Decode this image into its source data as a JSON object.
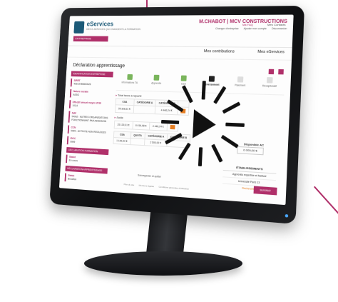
{
  "brand": {
    "name": "eServices",
    "tagline": "DES E-SERVICES QUI CHANGENT LA FORMATION"
  },
  "company": "M.CHABOT | MCV CONSTRUCTIONS",
  "top_links": [
    "Changer d'entreprise",
    "Ajouter mon compte",
    "Déconnexion"
  ],
  "entreprise_tab": "ENTREPRISE",
  "nav": {
    "contributions": "Mes contributions",
    "eservices": "Mes eServices",
    "faq": "Ma FAQ",
    "contacts": "Mes Contacts"
  },
  "page_title": "Déclaration apprentissage",
  "sidebar": {
    "id_head": "IDENTIFICATION ENTREPRISE",
    "items": [
      {
        "k": "SIRET",
        "v": "49914785600026"
      },
      {
        "k": "Nature sociale",
        "v": "ASSO"
      },
      {
        "k": "Effectif annuel moyen 2016",
        "v": "102,0"
      },
      {
        "k": "NAF",
        "v": "9499Z - AUTRES ORGANISATIONS FONCTIONNANT PAR ADHESION"
      },
      {
        "k": "CCN",
        "v": "9999 - ACTIVITE NON REGULEES"
      },
      {
        "k": "IDCC",
        "v": "9999"
      }
    ],
    "form_head": "DÉCLARATION FORMATION",
    "form_items": [
      {
        "k": "Statut",
        "v": "En cours"
      }
    ],
    "app_head": "DÉCLARATION APPRENTISSAGE",
    "app_items": [
      {
        "k": "Statut",
        "v": "Brouillon"
      }
    ]
  },
  "steps": [
    "Informations TA",
    "Apprentis",
    "CSA",
    "Reversement",
    "Paiement",
    "Récapitulatif"
  ],
  "section_total": "Total taxes à répartir",
  "table1": {
    "headers": [
      "CSA",
      "CATÉGORIE A",
      "CATÉGORIE B"
    ],
    "row": [
      "28 328,31 €",
      "",
      "4 446,24 €"
    ]
  },
  "section_solde": "Solde",
  "table2_row": [
    "25 130,31 €",
    "6 616,98 €",
    "4 446,24 €"
  ],
  "dispo": {
    "label": "Disponible AC",
    "value": "0 000,00 €"
  },
  "table3": {
    "headers": [
      "CSA",
      "QUOTA",
      "CATÉGORIE A",
      "CATÉGORIE B"
    ],
    "row": [
      "1 100,00 €",
      "",
      "2 500,00 €",
      ""
    ]
  },
  "etab": {
    "title": "ÉTABLISSEMENTS",
    "rows": [
      "Apprentis expertise et festival",
      "Université Paris 13"
    ],
    "search": "Rechercher"
  },
  "ajout": "AJOUTER UN ÉTABLISSEMENT",
  "precedent": "PRÉCÉDENT",
  "sauvegarder": "Sauvegarder et quitter",
  "suivant": "SUIVANT",
  "footer": [
    "Plan du site",
    "Mentions légales",
    "Conditions générales d'utilisation"
  ]
}
